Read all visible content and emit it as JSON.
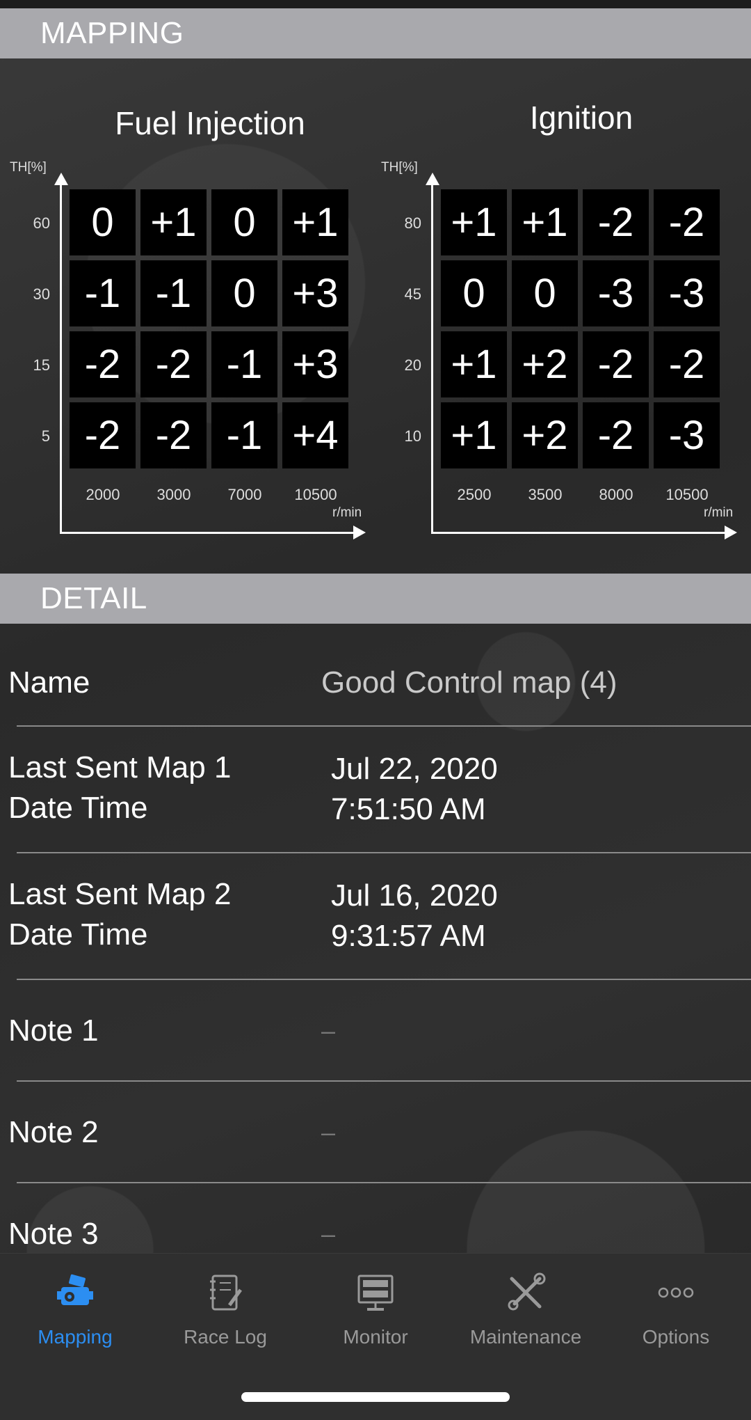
{
  "sections": {
    "mapping_title": "MAPPING",
    "detail_title": "DETAIL"
  },
  "fuel": {
    "title": "Fuel Injection",
    "y_axis_label": "TH[%]",
    "y_ticks": [
      "60",
      "30",
      "15",
      "5"
    ],
    "x_ticks": [
      "2000",
      "3000",
      "7000",
      "10500"
    ],
    "x_unit": "r/min",
    "grid": [
      [
        "0",
        "+1",
        "0",
        "+1"
      ],
      [
        "-1",
        "-1",
        "0",
        "+3"
      ],
      [
        "-2",
        "-2",
        "-1",
        "+3"
      ],
      [
        "-2",
        "-2",
        "-1",
        "+4"
      ]
    ]
  },
  "ignition": {
    "title": "Ignition",
    "y_axis_label": "TH[%]",
    "y_ticks": [
      "80",
      "45",
      "20",
      "10"
    ],
    "x_ticks": [
      "2500",
      "3500",
      "8000",
      "10500"
    ],
    "x_unit": "r/min",
    "grid": [
      [
        "+1",
        "+1",
        "-2",
        "-2"
      ],
      [
        "0",
        "0",
        "-3",
        "-3"
      ],
      [
        "+1",
        "+2",
        "-2",
        "-2"
      ],
      [
        "+1",
        "+2",
        "-2",
        "-3"
      ]
    ]
  },
  "detail": {
    "name_label": "Name",
    "name_value": "Good Control map (4)",
    "map1_label_line1": "Last Sent Map 1",
    "map1_label_line2": "Date Time",
    "map1_date": "Jul 22, 2020",
    "map1_time": "7:51:50 AM",
    "map2_label_line1": "Last Sent Map 2",
    "map2_label_line2": "Date Time",
    "map2_date": "Jul 16, 2020",
    "map2_time": "9:31:57 AM",
    "note1_label": "Note 1",
    "note1_value": "–",
    "note2_label": "Note 2",
    "note2_value": "–",
    "note3_label": "Note 3",
    "note3_value": "–"
  },
  "tabs": [
    {
      "label": "Mapping",
      "icon": "engine-icon",
      "active": true
    },
    {
      "label": "Race Log",
      "icon": "notebook-icon",
      "active": false
    },
    {
      "label": "Monitor",
      "icon": "monitor-icon",
      "active": false
    },
    {
      "label": "Maintenance",
      "icon": "tools-icon",
      "active": false
    },
    {
      "label": "Options",
      "icon": "more-icon",
      "active": false
    }
  ],
  "colors": {
    "accent": "#2c8ef1",
    "header_bg": "#a9a9ad",
    "cell_bg": "#000000"
  }
}
